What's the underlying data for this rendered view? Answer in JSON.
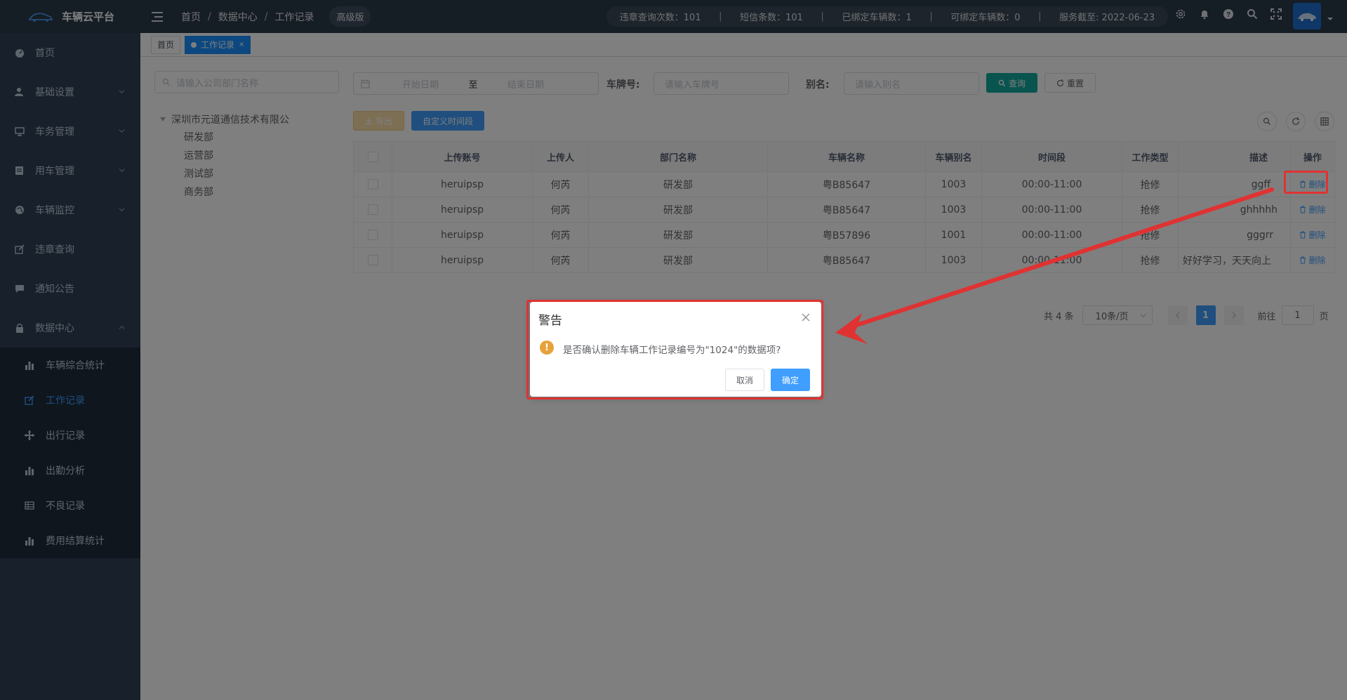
{
  "app": {
    "title": "车辆云平台",
    "edition": "高级版"
  },
  "breadcrumb": [
    "首页",
    "数据中心",
    "工作记录"
  ],
  "stats": [
    "违章查询次数：101",
    "短信条数：101",
    "已绑定车辆数：1",
    "可绑定车辆数：0",
    "服务截至: 2022-06-23"
  ],
  "stats_separator": "|",
  "top_icons": [
    "gear-icon",
    "bell-icon",
    "help-icon",
    "search-icon",
    "fullscreen-icon"
  ],
  "sidebar": {
    "items": [
      {
        "label": "首页",
        "icon": "dashboard-icon"
      },
      {
        "label": "基础设置",
        "icon": "user-icon"
      },
      {
        "label": "车务管理",
        "icon": "monitor-icon"
      },
      {
        "label": "用车管理",
        "icon": "form-icon"
      },
      {
        "label": "车辆监控",
        "icon": "globe-icon"
      },
      {
        "label": "违章查询",
        "icon": "edit-icon"
      },
      {
        "label": "通知公告",
        "icon": "message-icon"
      },
      {
        "label": "数据中心",
        "icon": "lock-icon"
      }
    ],
    "submenu": [
      {
        "label": "车辆综合统计",
        "icon": "bar-chart-icon"
      },
      {
        "label": "工作记录",
        "icon": "edit-icon"
      },
      {
        "label": "出行记录",
        "icon": "move-icon"
      },
      {
        "label": "出勤分析",
        "icon": "bar-chart-icon"
      },
      {
        "label": "不良记录",
        "icon": "table-icon"
      },
      {
        "label": "费用结算统计",
        "icon": "bar-chart-icon"
      }
    ]
  },
  "tabs": [
    {
      "label": "首页"
    },
    {
      "label": "工作记录",
      "close": "×"
    }
  ],
  "filters": {
    "dept_placeholder": "请输入公司部门名称",
    "start_placeholder": "开始日期",
    "range_sep": "至",
    "end_placeholder": "结束日期",
    "plate_label": "车牌号:",
    "plate_placeholder": "请输入车牌号",
    "alias_label": "别名:",
    "alias_placeholder": "请输入别名",
    "search_btn": "查询",
    "reset_btn": "重置"
  },
  "tree": {
    "root": "深圳市元道通信技术有限公",
    "children": [
      "研发部",
      "运营部",
      "测试部",
      "商务部"
    ]
  },
  "toolbar": {
    "export_btn": "导出",
    "custom_btn": "自定义时间段"
  },
  "table": {
    "headers": [
      "上传账号",
      "上传人",
      "部门名称",
      "车辆名称",
      "车辆别名",
      "时间段",
      "工作类型",
      "描述",
      "操作"
    ],
    "rows": [
      [
        "heruipsp",
        "何芮",
        "研发部",
        "粤B85647",
        "1003",
        "00:00-11:00",
        "抢修",
        "ggff"
      ],
      [
        "heruipsp",
        "何芮",
        "研发部",
        "粤B85647",
        "1003",
        "00:00-11:00",
        "抢修",
        "ghhhhh"
      ],
      [
        "heruipsp",
        "何芮",
        "研发部",
        "粤B57896",
        "1001",
        "00:00-11:00",
        "抢修",
        "gggrr"
      ],
      [
        "heruipsp",
        "何芮",
        "研发部",
        "粤B85647",
        "1003",
        "00:00-11:00",
        "抢修",
        "好好学习，天天向上"
      ]
    ],
    "action_label": "删除"
  },
  "pagination": {
    "total": "共 4 条",
    "page_size": "10条/页",
    "current": "1",
    "goto_label": "前往",
    "goto_value": "1",
    "page_suffix": "页"
  },
  "dialog": {
    "title": "警告",
    "message": "是否确认删除车辆工作记录编号为\"1024\"的数据项?",
    "cancel": "取消",
    "confirm": "确定",
    "icon": "!"
  },
  "colors": {
    "topbar": "#2b3a4a",
    "sidebar": "#304156",
    "primary": "#409eff",
    "success": "#13a89e",
    "warning": "#e6a23c",
    "annotation": "#e03232"
  }
}
